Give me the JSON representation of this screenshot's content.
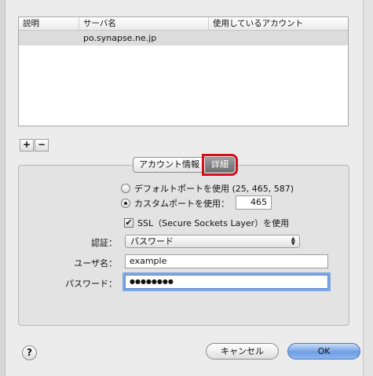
{
  "table": {
    "headers": [
      "説明",
      "サーバ名",
      "使用しているアカウント"
    ],
    "rows": [
      {
        "description": "",
        "server": "po.synapse.ne.jp",
        "account": ""
      }
    ]
  },
  "list_controls": {
    "add": "+",
    "remove": "−"
  },
  "tabs": [
    {
      "label": "アカウント情報",
      "active": false
    },
    {
      "label": "詳細",
      "active": true
    }
  ],
  "port": {
    "default_label": "デフォルトポートを使用 (25, 465, 587)",
    "default_selected": false,
    "custom_label": "カスタムポートを使用：",
    "custom_selected": true,
    "custom_value": "465"
  },
  "ssl": {
    "label": "SSL（Secure Sockets Layer）を使用",
    "checked": true
  },
  "auth": {
    "label": "認証：",
    "value": "パスワード"
  },
  "username": {
    "label": "ユーザ名：",
    "value": "example"
  },
  "password": {
    "label": "パスワード：",
    "value": "●●●●●●●●"
  },
  "footer": {
    "help": "?",
    "cancel": "キャンセル",
    "ok": "OK"
  },
  "colors": {
    "highlight_outline": "#d0101a",
    "ok_button": "#6f9fe3",
    "selected_row": "#dcdcdc"
  }
}
